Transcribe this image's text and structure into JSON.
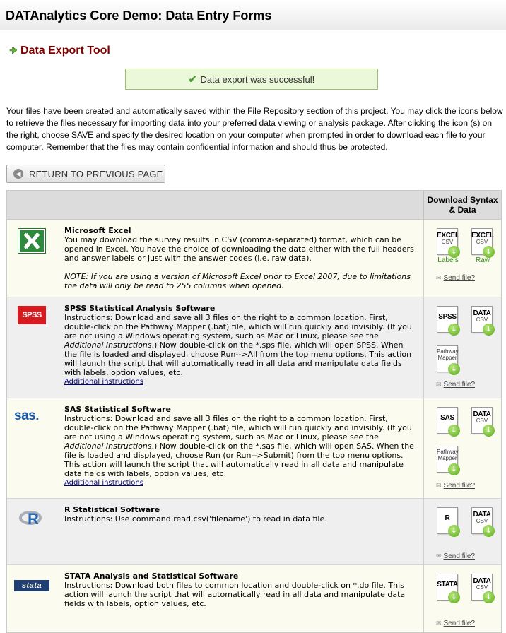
{
  "header": {
    "title": "DATAnalytics Core Demo: Data Entry Forms"
  },
  "tool": {
    "title": "Data Export Tool",
    "icon": "export-arrow-icon"
  },
  "status": {
    "message": "Data export was successful!",
    "icon": "checkmark-icon",
    "color": "#4aa02c"
  },
  "intro": "Your files have been created and automatically saved within the File Repository section of this project. You may click the icons below to retrieve the files necessary for importing data into your preferred data viewing or analysis package. After clicking the icon (s) on the right, choose SAVE and specify the desired location on your computer when prompted in order to download each file to your computer. Remember that the files may contain confidential information and should thus be protected.",
  "return_button": {
    "label": "RETURN TO PREVIOUS PAGE",
    "icon": "back-arrow-icon"
  },
  "table": {
    "download_header": "Download Syntax & Data",
    "send_file_label": "Send file?",
    "additional_instructions_label": "Additional instructions",
    "rows": [
      {
        "title": "Microsoft Excel",
        "logo": "excel-logo-icon",
        "description": "You may download the survey results in CSV (comma-separated) format, which can be opened in Excel. You have the choice of downloading the data either with the full headers and answer labels or just with the answer codes (i.e. raw data).",
        "note": "NOTE: If you are using a version of Microsoft Excel prior to Excel 2007, due to limitations the data will only be read to 255 columns when opened.",
        "files": [
          {
            "t1": "EXCEL",
            "t2": "CSV",
            "caption": "Labels"
          },
          {
            "t1": "EXCEL",
            "t2": "CSV",
            "caption": "Raw"
          }
        ]
      },
      {
        "title": "SPSS Statistical Analysis Software",
        "logo": "spss-logo-icon",
        "logo_text": "SPSS",
        "description_parts": [
          "Instructions: Download and save all 3 files on the right to a common location. First, double-click on the Pathway Mapper (.bat) file, which will run quickly and invisibly. (If you are not using a Windows operating system, such as Mac or Linux, please see the ",
          "Additional Instructions",
          ".) Now double-click on the *.sps file, which will open SPSS. When the file is loaded and displayed, choose Run-->All from the top menu options. This action will launch the script that will automatically read in all data and manipulate data fields with labels, option values, etc."
        ],
        "files": [
          {
            "t1": "SPSS"
          },
          {
            "t1": "DATA",
            "t2": "CSV"
          },
          {
            "t3": "Pathway Mapper"
          }
        ]
      },
      {
        "title": "SAS Statistical Software",
        "logo": "sas-logo-icon",
        "logo_text": "sas.",
        "description_parts": [
          "Instructions: Download and save all 3 files on the right to a common location. First, double-click on the Pathway Mapper (.bat) file, which will run quickly and invisibly. (If you are not using a Windows operating system, such as Mac or Linux, please see the ",
          "Additional Instructions",
          ".) Now double-click on the *.sas file, which will open SAS. When the file is loaded and displayed, choose Run (or Run-->Submit) from the top menu options. This action will launch the script that will automatically read in all data and manipulate data fields with labels, option values, etc."
        ],
        "files": [
          {
            "t1": "SAS"
          },
          {
            "t1": "DATA",
            "t2": "CSV"
          },
          {
            "t3": "Pathway Mapper"
          }
        ]
      },
      {
        "title": "R Statistical Software",
        "logo": "r-logo-icon",
        "logo_text": "R",
        "description": "Instructions: Use command read.csv('filename') to read in data file.",
        "files": [
          {
            "t1": "R"
          },
          {
            "t1": "DATA",
            "t2": "CSV"
          }
        ]
      },
      {
        "title": "STATA Analysis and Statistical Software",
        "logo": "stata-logo-icon",
        "logo_text": "stata",
        "description": "Instructions: Download both files to common location and double-click on *.do file. This action will launch the script that will automatically read in all data and manipulate data fields with labels, option values, etc.",
        "files": [
          {
            "t1": "STATA"
          },
          {
            "t1": "DATA",
            "t2": "CSV"
          }
        ]
      }
    ]
  },
  "colors": {
    "accent": "#800000",
    "success_bg": "#ebf8da",
    "link": "#000080",
    "download_green": "#58a618"
  }
}
